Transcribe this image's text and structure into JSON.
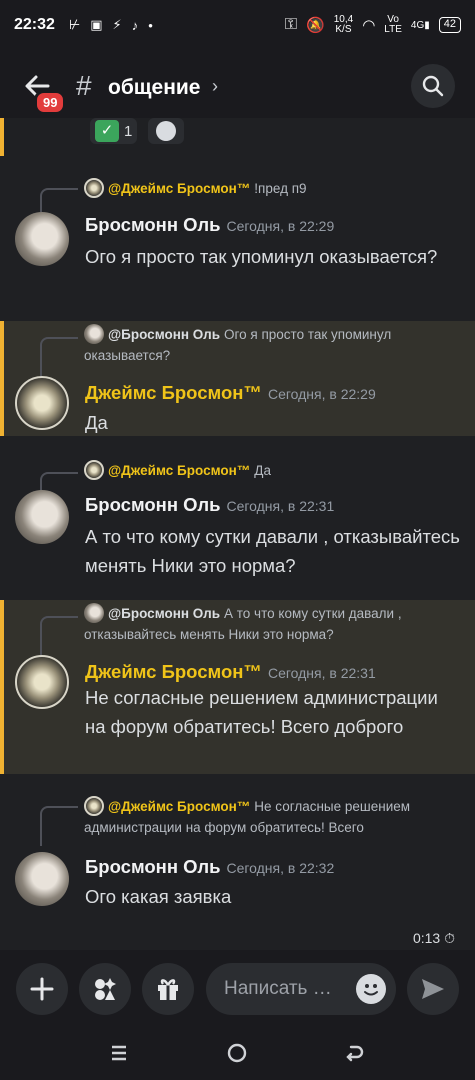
{
  "status": {
    "time": "22:32",
    "speed_value": "10,4",
    "speed_unit": "K/S",
    "vo_top": "Vo",
    "vo_bottom": "LTE",
    "network": "4G",
    "battery": "42"
  },
  "header": {
    "unread_badge": "99",
    "channel_hash": "#",
    "channel_name": "общение",
    "chevron": "›"
  },
  "reactions": [
    {
      "count": "1"
    }
  ],
  "messages": [
    {
      "reply_author": "@Джеймс Бросмон™",
      "reply_text": "!пред п9",
      "author": "Бросмонн Оль",
      "time": "Сегодня, в 22:29",
      "text": "Ого я просто так упоминул оказывается?"
    },
    {
      "reply_author": "@Бросмонн Оль",
      "reply_text": "Ого я просто так упоминул оказывается?",
      "author": "Джеймс Бросмон™",
      "time": "Сегодня, в 22:29",
      "text": "Да"
    },
    {
      "reply_author": "@Джеймс Бросмон™",
      "reply_text": "Да",
      "author": "Бросмонн Оль",
      "time": "Сегодня, в 22:31",
      "text": "А то что кому сутки давали , отказывайтесь менять Ники это норма?"
    },
    {
      "reply_author": "@Бросмонн Оль",
      "reply_text": "А то что кому сутки давали , отказывайтесь менять Ники это норма?",
      "author": "Джеймс Бросмон™",
      "time": "Сегодня, в 22:31",
      "text": "Не согласные решением администрации на форум обратитесь! Всего доброго"
    },
    {
      "reply_author": "@Джеймс Бросмон™",
      "reply_text": "Не согласные решением администрации на форум обратитесь! Всего",
      "author": "Бросмонн Оль",
      "time": "Сегодня, в 22:32",
      "text": "Ого какая заявка"
    }
  ],
  "timer": "0:13",
  "composer": {
    "placeholder": "Написать …"
  },
  "colors": {
    "background": "#1f2023",
    "mention_bg": "#33322c",
    "mention_bar": "#f0b232",
    "gold_name": "#f0c419",
    "badge": "#e23c3c"
  },
  "icons": [
    "back-arrow-icon",
    "search-icon",
    "plus-icon",
    "apps-icon",
    "gift-icon",
    "emoji-icon",
    "send-icon",
    "menu-icon",
    "home-icon",
    "back-icon"
  ]
}
